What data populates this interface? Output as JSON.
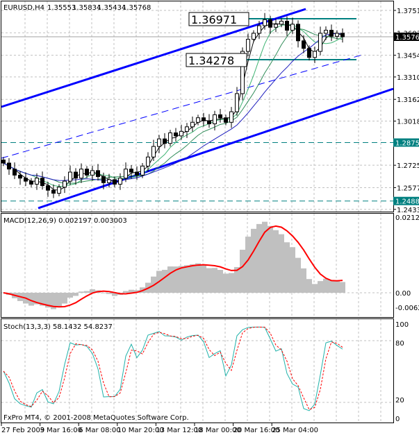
{
  "header": {
    "symbol": "EURUSD,H4",
    "open": "1.35553",
    "high": "1.35834",
    "low": "1.35434",
    "close": "1.35768"
  },
  "macd_label": "MACD(12,26,9) 0.002197 0.003003",
  "stoch_label": "Stoch(13,3,3) 58.1432 54.8237",
  "copyright": "FxPro MT4, © 2001-2008 MetaQuotes Software Corp.",
  "levels": {
    "upper": "1.36971",
    "lower": "1.34278",
    "current": "1.35768",
    "h1": "1.28757",
    "h2": "1.24885"
  },
  "colors": {
    "channel": "#0000ff",
    "level": "#008080",
    "signal": "#ff0000",
    "hist": "#c0c0c0",
    "k": "#20b2aa",
    "d": "#ff0000"
  },
  "chart_data": [
    {
      "type": "candlestick",
      "title": "EURUSD,H4",
      "price_ticks": [
        "1.37515",
        "1.36030",
        "1.34545",
        "1.33105",
        "1.31620",
        "1.30180",
        "1.27255",
        "1.25770",
        "1.24330"
      ],
      "ylim": [
        1.2433,
        1.37515
      ],
      "time_ticks": [
        "27 Feb 2009",
        "3 Mar 16:00",
        "6 Mar 08:00",
        "10 Mar 20:00",
        "13 Mar 12:00",
        "18 Mar 00:00",
        "20 Mar 16:00",
        "25 Mar 04:00"
      ],
      "closes": [
        1.274,
        1.27,
        1.266,
        1.264,
        1.262,
        1.26,
        1.264,
        1.259,
        1.256,
        1.254,
        1.258,
        1.262,
        1.268,
        1.264,
        1.27,
        1.266,
        1.269,
        1.265,
        1.261,
        1.263,
        1.26,
        1.264,
        1.27,
        1.268,
        1.266,
        1.272,
        1.278,
        1.285,
        1.29,
        1.287,
        1.294,
        1.292,
        1.295,
        1.298,
        1.301,
        1.304,
        1.302,
        1.3,
        1.306,
        1.304,
        1.301,
        1.308,
        1.32,
        1.348,
        1.356,
        1.36,
        1.365,
        1.369,
        1.364,
        1.366,
        1.368,
        1.362,
        1.366,
        1.355,
        1.35,
        1.344,
        1.348,
        1.36,
        1.362,
        1.358,
        1.36,
        1.35768
      ]
    },
    {
      "type": "macd",
      "ticks": [
        "0.02125",
        "0.00",
        "-0.00629"
      ],
      "ylim": [
        -0.00629,
        0.02125
      ]
    },
    {
      "type": "stochastic",
      "ticks": [
        "100",
        "80",
        "20",
        "0"
      ],
      "ylim": [
        0,
        100
      ]
    }
  ]
}
